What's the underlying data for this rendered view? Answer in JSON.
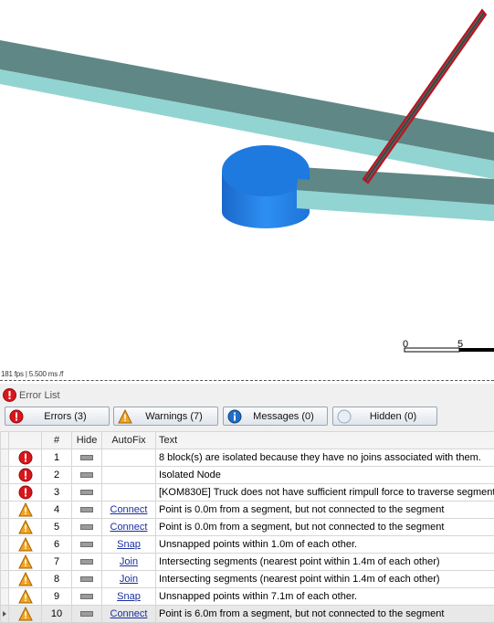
{
  "viewport": {
    "scale_labels": [
      "0",
      "5"
    ],
    "fps_text": "181 fps | 5.500 ms /f"
  },
  "panel": {
    "title": "Error List",
    "tabs": [
      {
        "label": "Errors (3)",
        "icon": "error-icon"
      },
      {
        "label": "Warnings (7)",
        "icon": "warning-icon"
      },
      {
        "label": "Messages (0)",
        "icon": "info-icon"
      },
      {
        "label": "Hidden (0)",
        "icon": "hidden-icon"
      }
    ],
    "columns": {
      "num": "#",
      "hide": "Hide",
      "autofix": "AutoFix",
      "text": "Text"
    },
    "rows": [
      {
        "type": "error",
        "num": "1",
        "autofix": "",
        "text": "8 block(s) are isolated because they have no joins associated with them."
      },
      {
        "type": "error",
        "num": "2",
        "autofix": "",
        "text": "Isolated Node"
      },
      {
        "type": "error",
        "num": "3",
        "autofix": "",
        "text": "[KOM830E] Truck does not have sufficient rimpull force to traverse segment"
      },
      {
        "type": "warning",
        "num": "4",
        "autofix": "Connect",
        "text": "Point is 0.0m from a segment, but not connected to the segment"
      },
      {
        "type": "warning",
        "num": "5",
        "autofix": "Connect",
        "text": "Point is 0.0m from a segment, but not connected to the segment"
      },
      {
        "type": "warning",
        "num": "6",
        "autofix": "Snap",
        "text": "Unsnapped points within 1.0m of each other."
      },
      {
        "type": "warning",
        "num": "7",
        "autofix": "Join",
        "text": "Intersecting segments (nearest point within 1.4m of each other)"
      },
      {
        "type": "warning",
        "num": "8",
        "autofix": "Join",
        "text": "Intersecting segments (nearest point within 1.4m of each other)"
      },
      {
        "type": "warning",
        "num": "9",
        "autofix": "Snap",
        "text": "Unsnapped points within 7.1m of each other."
      },
      {
        "type": "warning",
        "num": "10",
        "autofix": "Connect",
        "text": "Point is 6.0m from a segment, but not connected to the segment",
        "selected": true
      }
    ]
  },
  "colors": {
    "error": "#d9161c",
    "warning": "#f2a31b",
    "info": "#1f6fc8",
    "road_top": "#5e8584",
    "road_side": "#8fd3d0",
    "node": "#1f7ae0"
  }
}
